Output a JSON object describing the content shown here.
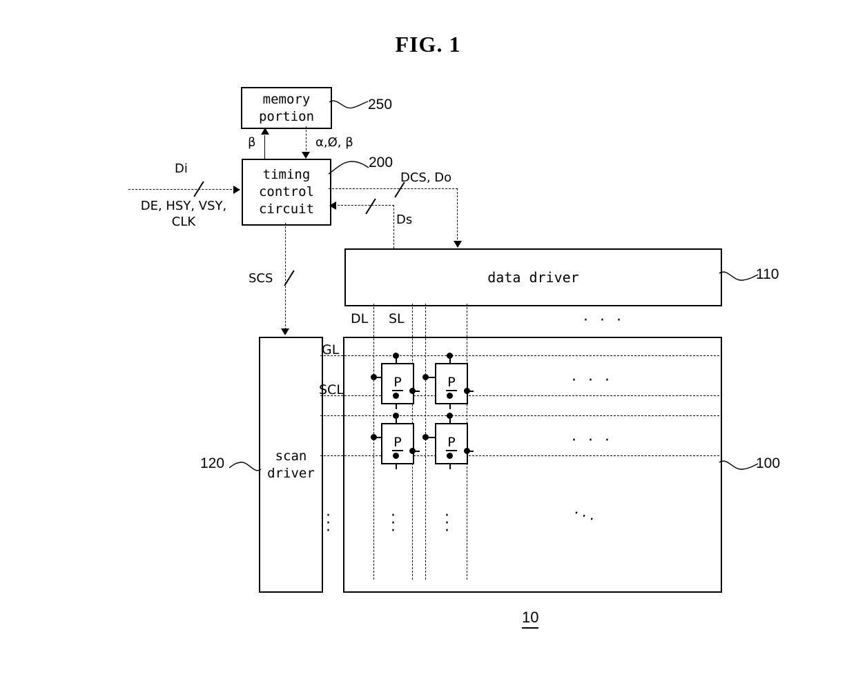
{
  "figure": {
    "title": "FIG. 1",
    "device_label": "10"
  },
  "blocks": {
    "memory_portion": {
      "label": "memory\nportion",
      "ref": "250"
    },
    "timing_control_circuit": {
      "label": "timing\ncontrol\ncircuit",
      "ref": "200"
    },
    "data_driver": {
      "label": "data driver",
      "ref": "110"
    },
    "scan_driver": {
      "label": "scan\ndriver",
      "ref": "120"
    },
    "display_panel": {
      "ref": "100"
    }
  },
  "signals": {
    "di": "Di",
    "inputs": "DE, HSY, VSY,\nCLK",
    "beta_up": "β",
    "alpha_phi_beta": "α,Ø, β",
    "dcs_do": "DCS, Do",
    "ds": "Ds",
    "scs": "SCS"
  },
  "panel_lines": {
    "dl": "DL",
    "sl": "SL",
    "gl": "GL",
    "scl": "SCL"
  },
  "pixel": {
    "label": "P"
  },
  "ellipsis": {
    "horizontal": "· · ·",
    "vertical": "·",
    "diagonal": "···"
  },
  "colors": {
    "line": "#000000",
    "background": "#ffffff"
  }
}
